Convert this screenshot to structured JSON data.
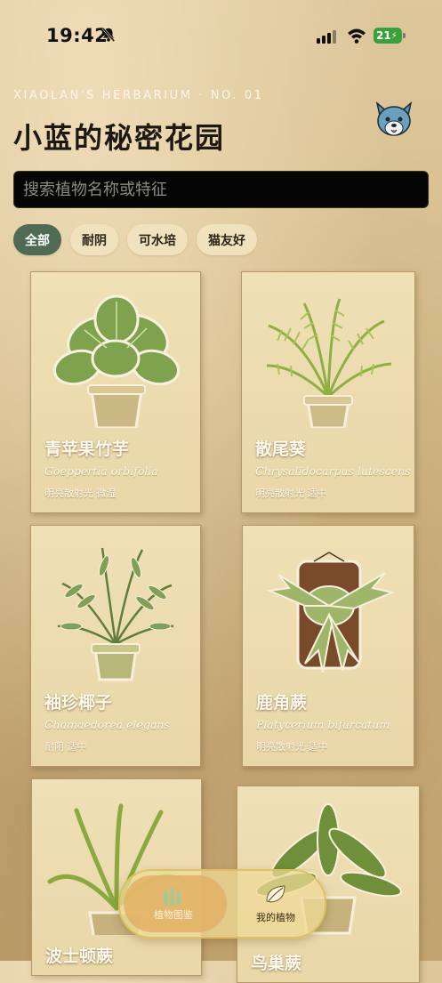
{
  "status": {
    "time": "19:42",
    "battery": "21"
  },
  "header": {
    "subtitle": "XIAOLAN'S HERBARIUM · NO. 01",
    "title": "小蓝的秘密花园"
  },
  "search": {
    "placeholder": "搜索植物名称或特征"
  },
  "filters": [
    {
      "label": "全部",
      "active": true
    },
    {
      "label": "耐阴"
    },
    {
      "label": "可水培"
    },
    {
      "label": "猫友好"
    }
  ],
  "plants": [
    {
      "name": "青苹果竹芋",
      "latin": "Goeppertia orbifolia",
      "tags": "明亮散射光   微湿"
    },
    {
      "name": "散尾葵",
      "latin": "Chrysalidocarpus lutescens",
      "tags": "明亮散射光   适中"
    },
    {
      "name": "袖珍椰子",
      "latin": "Chamaedorea elegans",
      "tags": "耐阴   适中"
    },
    {
      "name": "鹿角蕨",
      "latin": "Platycerium bifurcatum",
      "tags": "明亮散射光   适中"
    },
    {
      "name": "波士顿蕨",
      "latin": "",
      "tags": ""
    },
    {
      "name": "鸟巢蕨",
      "latin": "",
      "tags": ""
    }
  ],
  "tabbar": {
    "tab1": "植物图鉴",
    "tab2": "我的植物"
  },
  "colors": {
    "accent": "#4f6b53",
    "chip": "#efe2bd",
    "card": "#ebdab0"
  }
}
